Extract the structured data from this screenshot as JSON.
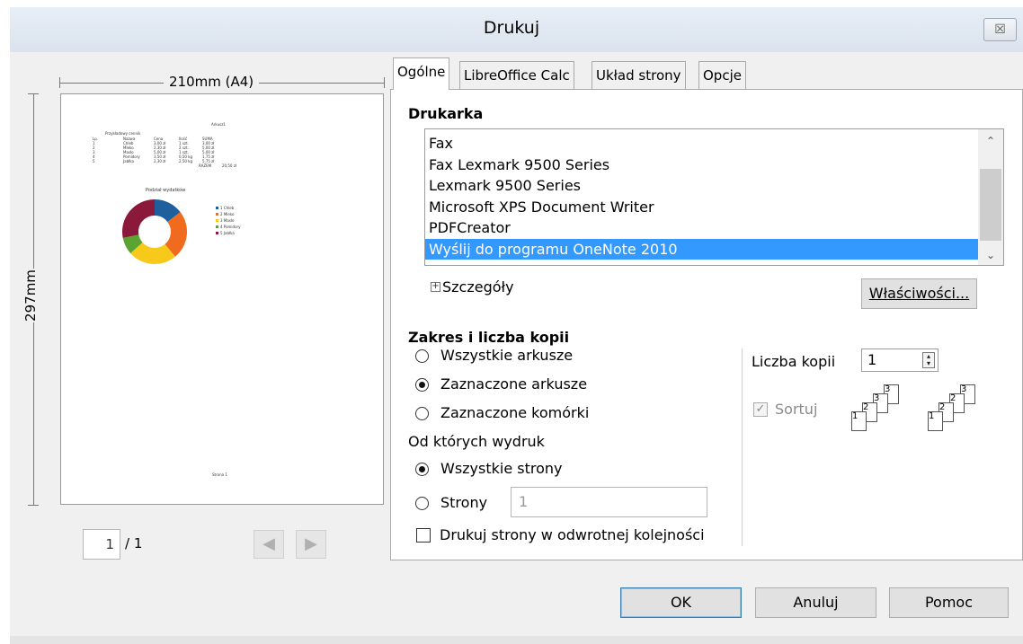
{
  "window": {
    "title": "Drukuj",
    "close_glyph": "☒"
  },
  "preview": {
    "width_label": "210mm (A4)",
    "height_label": "297mm",
    "page_number": "1",
    "page_total": "/ 1",
    "thumbnail": {
      "sheet_title": "Arkusz1",
      "heading": "Przykładowy cennik",
      "columns": [
        "Lp.",
        "Nazwa",
        "Cena",
        "Ilość",
        "SUMA"
      ],
      "rows": [
        [
          "1",
          "Chleb",
          "3,00 zł",
          "1 szt.",
          "3,00 zł"
        ],
        [
          "2",
          "Mleko",
          "2,30 zł",
          "2 szt.",
          "5,00 zł"
        ],
        [
          "3",
          "Masło",
          "5,00 zł",
          "1 szt.",
          "5,00 zł"
        ],
        [
          "4",
          "Pomidory",
          "3,50 zł",
          "0,50 kg",
          "1,75 zł"
        ],
        [
          "5",
          "Jabłka",
          "2,30 zł",
          "2,50 kg",
          "5,75 zł"
        ]
      ],
      "total_label": "RAZEM",
      "total_value": "20,50 zł",
      "chart_title": "Podział wydatków",
      "legend": [
        "1 Chleb",
        "2 Mleko",
        "3 Masło",
        "4 Pomidory",
        "5 Jabłka"
      ],
      "footer": "Strona 1"
    }
  },
  "tabs": [
    {
      "label": "Ogólne",
      "active": true
    },
    {
      "label": "LibreOffice Calc",
      "active": false
    },
    {
      "label": "Układ strony",
      "active": false
    },
    {
      "label": "Opcje",
      "active": false
    }
  ],
  "printer": {
    "section_title": "Drukarka",
    "items": [
      "Fax",
      "Fax Lexmark 9500 Series",
      "Lexmark 9500 Series",
      "Microsoft XPS Document Writer",
      "PDFCreator",
      "Wyślij do programu OneNote 2010"
    ],
    "selected_index": 5,
    "details_label": "Szczegóły",
    "properties_button": "Właściwości..."
  },
  "range": {
    "section_title": "Zakres i liczba kopii",
    "sheets_options": [
      {
        "label": "Wszystkie arkusze",
        "checked": false
      },
      {
        "label": "Zaznaczone arkusze",
        "checked": true
      },
      {
        "label": "Zaznaczone komórki",
        "checked": false
      }
    ],
    "from_which_label": "Od których wydruk",
    "all_pages_label": "Wszystkie strony",
    "all_pages_checked": true,
    "pages_label": "Strony",
    "pages_value": "1",
    "reverse_label": "Drukuj strony w odwrotnej kolejności",
    "reverse_checked": false
  },
  "copies": {
    "label": "Liczba kopii",
    "value": "1",
    "collate_label": "Sortuj",
    "collate_checked": true,
    "collate_disabled": true
  },
  "buttons": {
    "ok": "OK",
    "cancel": "Anuluj",
    "help": "Pomoc"
  },
  "colors": {
    "selection": "#3399ff",
    "donut": [
      "#1f5f9e",
      "#f06b1d",
      "#f7c91b",
      "#5aa532",
      "#8b1a3a"
    ]
  }
}
